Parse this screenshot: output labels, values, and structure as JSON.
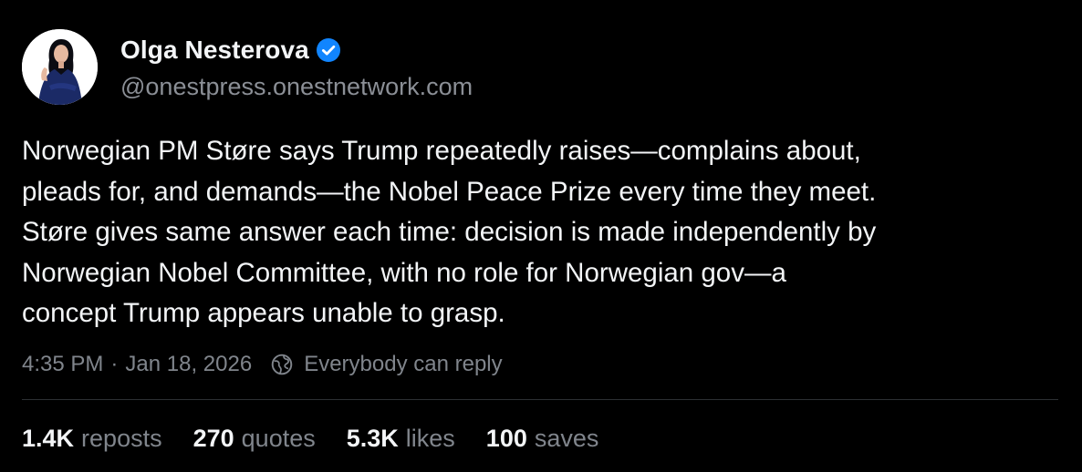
{
  "author": {
    "display_name": "Olga Nesterova",
    "handle": "@onestpress.onestnetwork.com",
    "verified": true,
    "avatar_icon": "person-portrait",
    "verified_icon": "verified-badge-icon"
  },
  "post": {
    "text_lines": [
      "Norwegian PM Støre says Trump repeatedly raises—complains about,",
      "pleads for, and demands—the Nobel Peace Prize every time they meet.",
      "Støre gives same answer each time: decision is made independently by",
      "Norwegian Nobel Committee, with no role for Norwegian gov—a",
      "concept Trump appears unable to grasp."
    ],
    "time": "4:35 PM",
    "separator": "·",
    "date": "Jan 18, 2026",
    "reply_setting_icon": "globe-icon",
    "reply_setting": "Everybody can reply"
  },
  "stats": [
    {
      "count": "1.4K",
      "label": "reposts"
    },
    {
      "count": "270",
      "label": "quotes"
    },
    {
      "count": "5.3K",
      "label": "likes"
    },
    {
      "count": "100",
      "label": "saves"
    }
  ],
  "colors": {
    "background": "#000000",
    "text_primary": "#f3f5f7",
    "text_secondary": "#80858c",
    "verified_blue": "#1185fe",
    "divider": "#2c2f33"
  }
}
